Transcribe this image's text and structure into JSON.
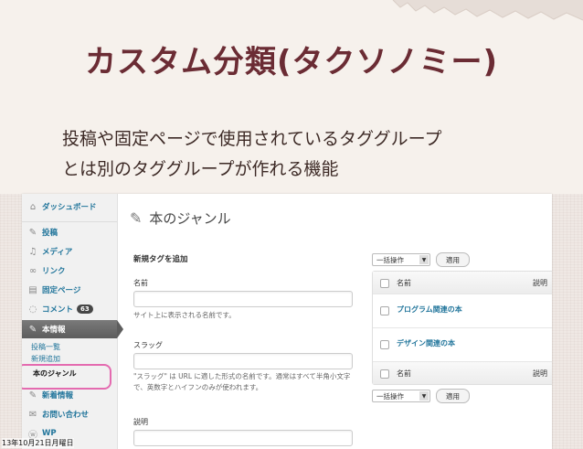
{
  "slide": {
    "title": "カスタム分類(タクソノミー)",
    "subtitle_line1": "投稿や固定ページで使用されているタググループ",
    "subtitle_line2": "とは別のタググループが作れる機能"
  },
  "sidebar": {
    "items": [
      {
        "label": "ダッシュボード",
        "icon": "dashboard-icon"
      },
      {
        "label": "投稿",
        "icon": "pin-icon"
      },
      {
        "label": "メディア",
        "icon": "media-icon"
      },
      {
        "label": "リンク",
        "icon": "link-icon"
      },
      {
        "label": "固定ページ",
        "icon": "page-icon"
      },
      {
        "label": "コメント",
        "icon": "comment-icon",
        "badge": "63"
      },
      {
        "label": "本情報",
        "icon": "pin-icon"
      }
    ],
    "subitems": [
      "投稿一覧",
      "新規追加",
      "本のジャンル"
    ],
    "after_items": [
      {
        "label": "新着情報",
        "icon": "pin-icon"
      },
      {
        "label": "お問い合わせ",
        "icon": "mail-icon"
      },
      {
        "label": "WP",
        "icon": "wp-icon"
      }
    ]
  },
  "main": {
    "page_title": "本のジャンル",
    "form_title": "新規タグを追加",
    "name_label": "名前",
    "name_help": "サイト上に表示される名前です。",
    "slug_label": "スラッグ",
    "slug_help": "\"スラッグ\" は URL に適した形式の名前です。通常はすべて半角小文字で、英数字とハイフンのみが使われます。",
    "desc_label": "説明",
    "bulk": {
      "select": "一括操作",
      "apply": "適用"
    },
    "table": {
      "col_name": "名前",
      "col_desc": "説明",
      "rows": [
        "プログラム関連の本",
        "デザイン関連の本"
      ]
    }
  },
  "footer": {
    "date": "13年10月21日月曜日"
  },
  "colors": {
    "title": "#6b2c34",
    "link": "#21759b",
    "highlight": "#e46bb0"
  }
}
